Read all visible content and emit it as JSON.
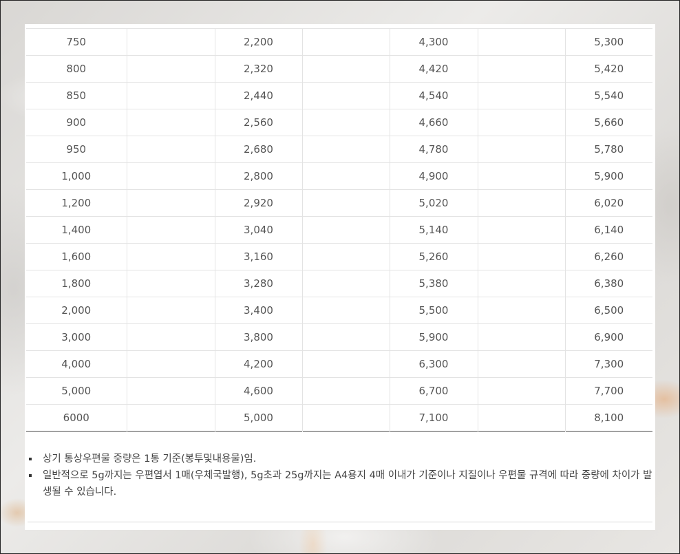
{
  "rate_table": {
    "rows": [
      [
        "750",
        "",
        "2,200",
        "",
        "4,300",
        "",
        "5,300"
      ],
      [
        "800",
        "",
        "2,320",
        "",
        "4,420",
        "",
        "5,420"
      ],
      [
        "850",
        "",
        "2,440",
        "",
        "4,540",
        "",
        "5,540"
      ],
      [
        "900",
        "",
        "2,560",
        "",
        "4,660",
        "",
        "5,660"
      ],
      [
        "950",
        "",
        "2,680",
        "",
        "4,780",
        "",
        "5,780"
      ],
      [
        "1,000",
        "",
        "2,800",
        "",
        "4,900",
        "",
        "5,900"
      ],
      [
        "1,200",
        "",
        "2,920",
        "",
        "5,020",
        "",
        "6,020"
      ],
      [
        "1,400",
        "",
        "3,040",
        "",
        "5,140",
        "",
        "6,140"
      ],
      [
        "1,600",
        "",
        "3,160",
        "",
        "5,260",
        "",
        "6,260"
      ],
      [
        "1,800",
        "",
        "3,280",
        "",
        "5,380",
        "",
        "6,380"
      ],
      [
        "2,000",
        "",
        "3,400",
        "",
        "5,500",
        "",
        "6,500"
      ],
      [
        "3,000",
        "",
        "3,800",
        "",
        "5,900",
        "",
        "6,900"
      ],
      [
        "4,000",
        "",
        "4,200",
        "",
        "6,300",
        "",
        "7,300"
      ],
      [
        "5,000",
        "",
        "4,600",
        "",
        "6,700",
        "",
        "7,700"
      ],
      [
        "6000",
        "",
        "5,000",
        "",
        "7,100",
        "",
        "8,100"
      ]
    ]
  },
  "notes": [
    "상기 통상우편물 중량은 1통 기준(봉투및내용물)임.",
    "일반적으로 5g까지는 우편엽서 1매(우체국발행), 5g초과 25g까지는 A4용지 4매 이내가 기준이나 지질이나 우편물 규격에 따라 중량에 차이가 발생될 수 있습니다."
  ]
}
